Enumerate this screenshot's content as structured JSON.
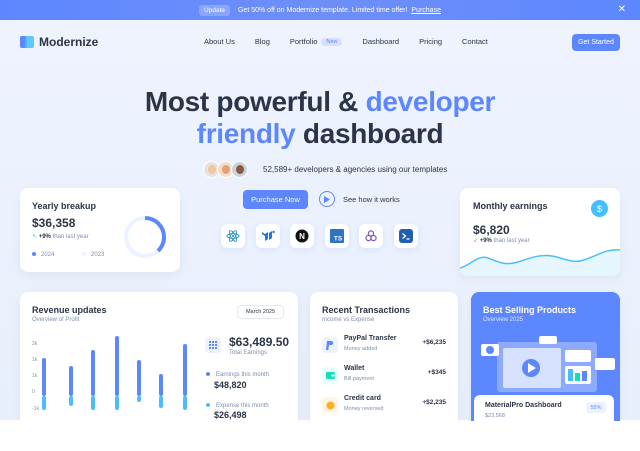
{
  "promo": {
    "badge": "Update",
    "text": "Get 50% off on Modernize template. Limited time offer!",
    "link": "Purchase"
  },
  "nav": {
    "brand": "Modernize",
    "links": [
      "About Us",
      "Blog",
      "Portfolio",
      "Dashboard",
      "Pricing",
      "Contact"
    ],
    "portfolio_badge": "New",
    "cta": "Get Started"
  },
  "hero": {
    "headline_part1": "Most powerful & ",
    "headline_accent1": "developer",
    "headline_accent2": "friendly",
    "headline_part2": " dashboard",
    "dev_count": "52,589+ developers & agencies using our templates",
    "primary_button": "Purchase Now",
    "secondary_button": "See how it works",
    "tech_icons": [
      "react-icon",
      "mui-icon",
      "nextjs-icon",
      "typescript-icon",
      "redux-icon",
      "shell-icon"
    ]
  },
  "yearly": {
    "title": "Yearly breakup",
    "amount": "$36,358",
    "change": "+9%",
    "change_label": "than last year",
    "legend": [
      "2024",
      "2023"
    ],
    "donut_fraction": 0.38
  },
  "monthly": {
    "title": "Monthly earnings",
    "amount": "$6,820",
    "change": "+9%",
    "change_label": "than last year"
  },
  "revenue": {
    "title": "Revenue updates",
    "subtitle": "Overview of Profit",
    "select": "March 2025",
    "total": "$63,489.50",
    "total_label": "Total Earnings",
    "earnings_label": "Earnings this month",
    "earnings": "$48,820",
    "expense_label": "Expense this month",
    "expense": "$26,498",
    "yticks": [
      "2k",
      "1k",
      "1k",
      "0",
      "-1k"
    ]
  },
  "transactions": {
    "title": "Recent Transactions",
    "subtitle": "Income vs Expense",
    "items": [
      {
        "name": "PayPal Transfer",
        "desc": "Money added",
        "amount": "+$6,235"
      },
      {
        "name": "Wallet",
        "desc": "Bill payment",
        "amount": "+$345"
      },
      {
        "name": "Credit card",
        "desc": "Money reversed",
        "amount": "+$2,235"
      }
    ]
  },
  "products": {
    "title": "Best Selling Products",
    "subtitle": "Overview 2025",
    "item_name": "MaterialPro Dashboard",
    "item_price": "$23,568",
    "item_percent": "55%"
  },
  "colors": {
    "primary": "#5d87ff",
    "secondary": "#49beff",
    "success": "#13deb9",
    "warning": "#ffae1f"
  }
}
